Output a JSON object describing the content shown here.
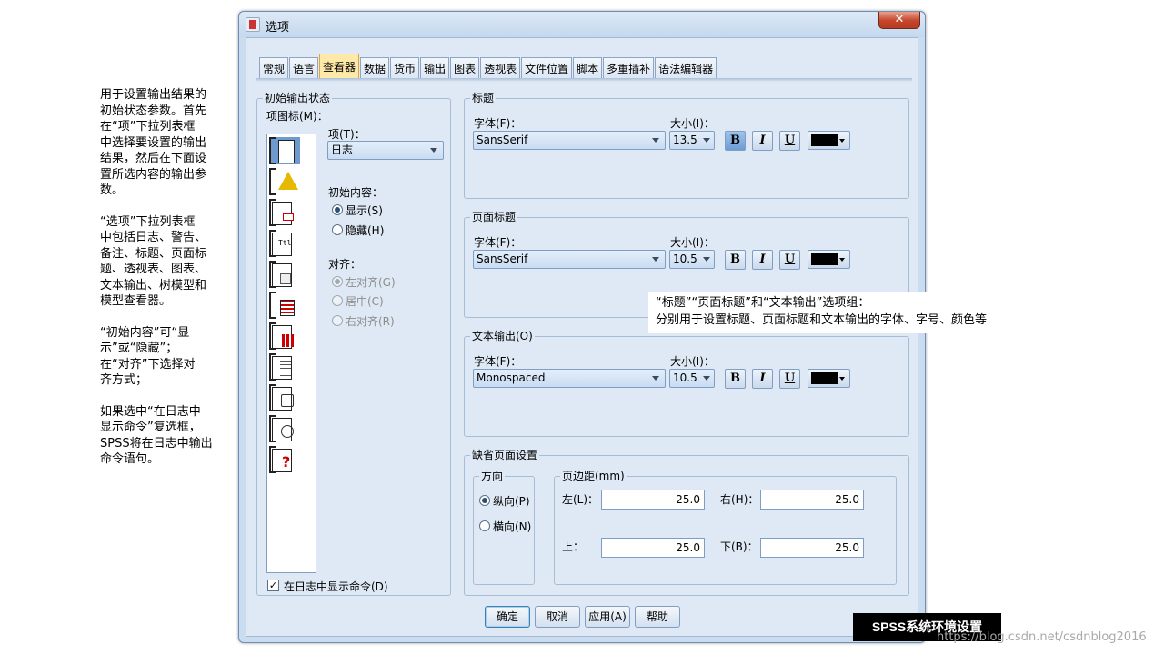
{
  "left_note": {
    "p1": "用于设置输出结果的\n初始状态参数。首先\n在“项”下拉列表框\n中选择要设置的输出\n结果，然后在下面设\n置所选内容的输出参\n数。",
    "p2": "“选项”下拉列表框\n中包括日志、警告、\n备注、标题、页面标\n题、透视表、图表、\n文本输出、树模型和\n模型查看器。",
    "p3": "“初始内容”可“显\n示”或“隐藏”；\n在“对齐”下选择对\n齐方式；",
    "p4": "如果选中“在日志中\n显示命令”复选框，\nSPSS将在日志中输出\n命令语句。"
  },
  "callout": {
    "line1": "“标题”“页面标题”和“文本输出”选项组：",
    "line2": "分别用于设置标题、页面标题和文本输出的字体、字号、颜色等"
  },
  "dialog": {
    "title": "选项",
    "close": "✕",
    "tabs": [
      "常规",
      "语言",
      "查看器",
      "数据",
      "货币",
      "输出",
      "图表",
      "透视表",
      "文件位置",
      "脚本",
      "多重插补",
      "语法编辑器"
    ],
    "active_tab": "查看器"
  },
  "initial_state": {
    "legend": "初始输出状态",
    "icon_label": "项图标(M)：",
    "item_label": "项(T)：",
    "item_value": "日志",
    "content_label": "初始内容：",
    "show": "显示(S)",
    "hide": "隐藏(H)",
    "align_label": "对齐：",
    "left": "左对齐(G)",
    "center": "居中(C)",
    "right": "右对齐(R)",
    "log_cmd": "在日志中显示命令(D)",
    "icons": [
      "log-icon",
      "warning-icon",
      "note-icon",
      "title-icon",
      "page-title-icon",
      "pivot-table-icon",
      "chart-icon",
      "text-output-icon",
      "tree-model-icon",
      "model-viewer-icon",
      "unknown-object-icon"
    ]
  },
  "title_group": {
    "legend": "标题",
    "font_label": "字体(F)：",
    "font": "SansSerif",
    "size_label": "大小(I)：",
    "size": "13.5",
    "bold": "B",
    "italic": "I",
    "underline": "U",
    "color": "#000000"
  },
  "page_title_group": {
    "legend": "页面标题",
    "font_label": "字体(F)：",
    "font": "SansSerif",
    "size_label": "大小(I)：",
    "size": "10.5",
    "bold": "B",
    "italic": "I",
    "underline": "U",
    "color": "#000000"
  },
  "text_output_group": {
    "legend": "文本输出(O)",
    "font_label": "字体(F)：",
    "font": "Monospaced",
    "size_label": "大小(I)：",
    "size": "10.5",
    "bold": "B",
    "italic": "I",
    "underline": "U",
    "color": "#000000"
  },
  "page_setup": {
    "legend": "缺省页面设置",
    "orientation_legend": "方向",
    "portrait": "纵向(P)",
    "landscape": "横向(N)",
    "margins_legend": "页边距(mm)",
    "left_label": "左(L)：",
    "left_value": "25.0",
    "right_label": "右(H)：",
    "right_value": "25.0",
    "top_label": "上：",
    "top_value": "25.0",
    "bottom_label": "下(B)：",
    "bottom_value": "25.0"
  },
  "buttons": {
    "ok": "确定",
    "cancel": "取消",
    "apply": "应用(A)",
    "help": "帮助"
  },
  "caption": "SPSS系统环境设置",
  "watermark": "https://blog.csdn.net/csdnblog2016"
}
